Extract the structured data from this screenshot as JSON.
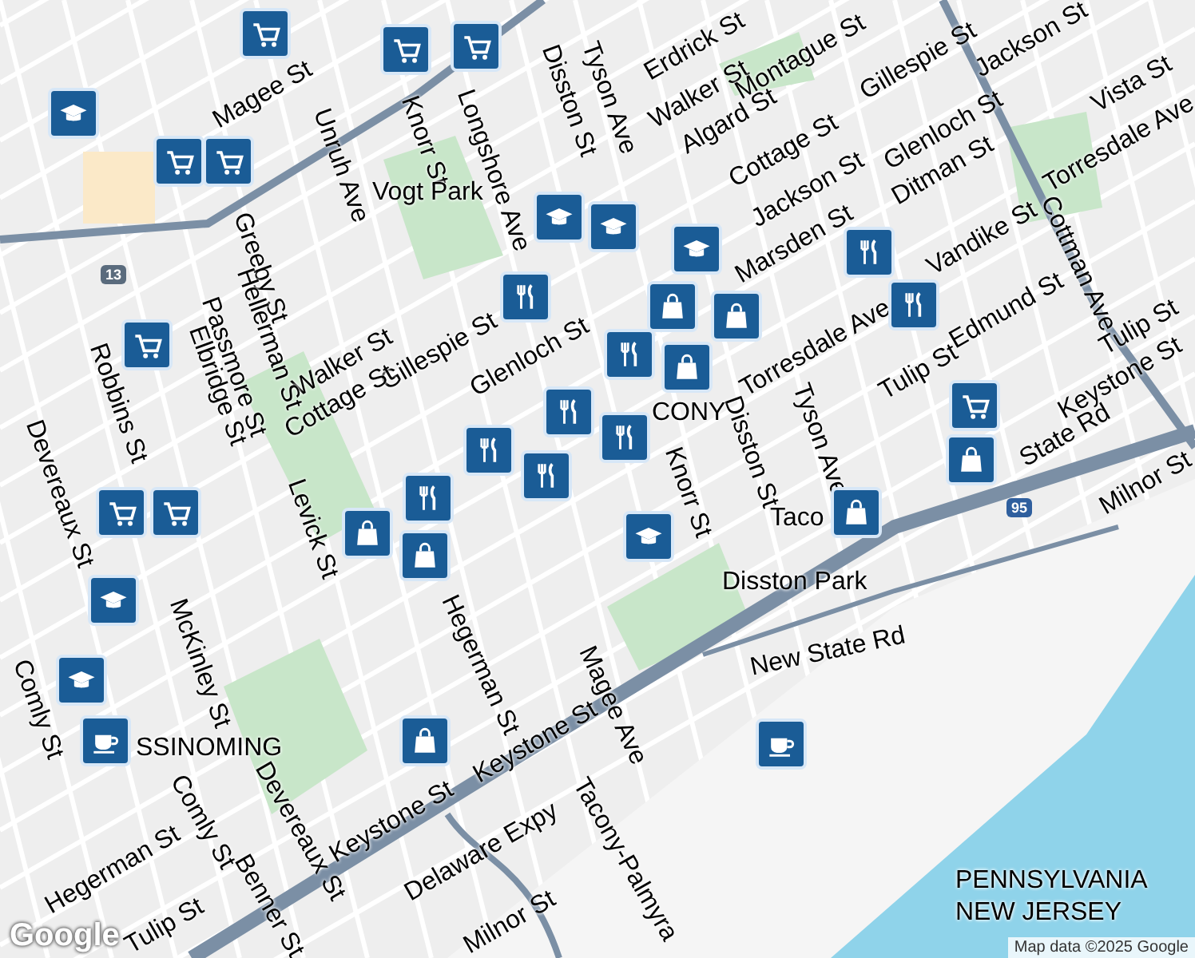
{
  "map": {
    "streets": [
      "Tyson Ave",
      "Disston St",
      "Erdrick St",
      "Walker St",
      "Montague St",
      "Gillespie St",
      "Jackson St",
      "Algard St",
      "Cottage St",
      "Glenloch St",
      "Ditman St",
      "Torresdale Ave",
      "Vista St",
      "Jackson St",
      "Cottman Ave",
      "Tulip St",
      "Keystone St",
      "Tulip St",
      "State Rd",
      "Milnor St",
      "Taco",
      "New State Rd",
      "Delaware Expy",
      "Tacony-Palmyra",
      "Milnor St",
      "Keystone St",
      "Hegerman St",
      "Tulip St",
      "Comly St",
      "Benner St",
      "Devereaux St",
      "Keystone St",
      "Magee Ave",
      "Hegerman St",
      "Knorr St",
      "Glenloch St",
      "Gillespie St",
      "Walker St",
      "Cottage St",
      "Levick St",
      "Unruh Ave",
      "Knorr St",
      "Longshore Ave",
      "Magee St",
      "Greeby St",
      "Hellerman St",
      "Passmore St",
      "Elbridge St",
      "Robbins St",
      "McKinley St",
      "Devereaux St",
      "Comly St",
      "Marsden St",
      "Torresdale Ave",
      "Vandike St",
      "Edmund St",
      "Tyson Ave",
      "Disston St"
    ],
    "parks": [
      "Disston Park",
      "Vogt Park"
    ],
    "districts": [
      "SSINOMING",
      "CONY"
    ],
    "states": [
      "PENNSYLVANIA",
      "NEW JERSEY"
    ],
    "shields": [
      {
        "text": "13",
        "kind": "us"
      },
      {
        "text": "95",
        "kind": "interstate"
      }
    ],
    "markers": [
      {
        "kind": "cart"
      },
      {
        "kind": "cart"
      },
      {
        "kind": "cart"
      },
      {
        "kind": "cart"
      },
      {
        "kind": "cart"
      },
      {
        "kind": "cart"
      },
      {
        "kind": "cart"
      },
      {
        "kind": "cart"
      },
      {
        "kind": "cart"
      },
      {
        "kind": "school"
      },
      {
        "kind": "school"
      },
      {
        "kind": "school"
      },
      {
        "kind": "school"
      },
      {
        "kind": "school"
      },
      {
        "kind": "school"
      },
      {
        "kind": "school"
      },
      {
        "kind": "food"
      },
      {
        "kind": "food"
      },
      {
        "kind": "food"
      },
      {
        "kind": "food"
      },
      {
        "kind": "food"
      },
      {
        "kind": "food"
      },
      {
        "kind": "food"
      },
      {
        "kind": "food"
      },
      {
        "kind": "food"
      },
      {
        "kind": "bag"
      },
      {
        "kind": "bag"
      },
      {
        "kind": "bag"
      },
      {
        "kind": "bag"
      },
      {
        "kind": "bag"
      },
      {
        "kind": "bag"
      },
      {
        "kind": "bag"
      },
      {
        "kind": "bag"
      },
      {
        "kind": "cup"
      },
      {
        "kind": "cup"
      }
    ],
    "attribution": "Map data ©2025 Google",
    "logo": "Google"
  }
}
